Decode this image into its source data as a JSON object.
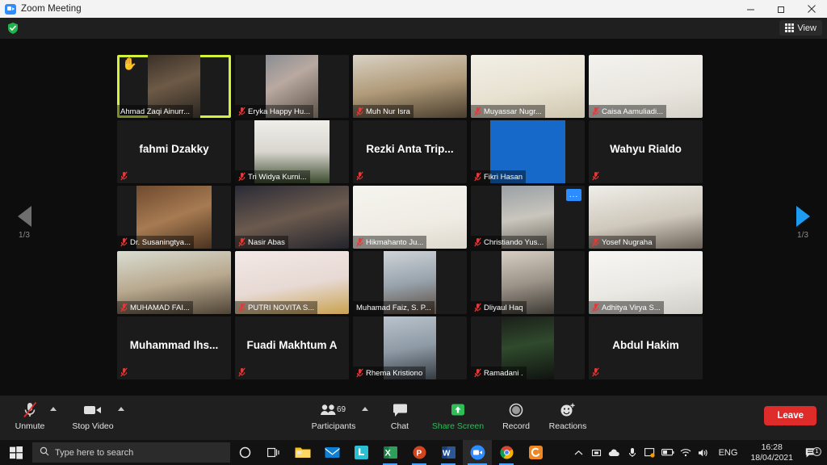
{
  "window": {
    "title": "Zoom Meeting",
    "app_icon": "zoom-icon",
    "minimize_label": "Minimize",
    "maximize_label": "Maximize",
    "close_label": "Close"
  },
  "topbar": {
    "shield_icon": "encryption-shield-icon",
    "view_label": "View",
    "view_icon": "grid-view-icon"
  },
  "page_nav": {
    "prev_label": "1/3",
    "next_label": "1/3",
    "prev_icon": "chevron-left-icon",
    "next_icon": "chevron-right-icon",
    "prev_color": "#6e6e6e",
    "next_color": "#1d9bf0"
  },
  "gallery": {
    "active_speaker_color": "#d4f23a",
    "participants": [
      {
        "name": "Ahmad Zaqi Ainurr...",
        "video": true,
        "muted": false,
        "hand_raised": true,
        "speaking": true,
        "name_style": "bar",
        "crop": "narrow"
      },
      {
        "name": "Eryka Happy Hu...",
        "video": true,
        "muted": true,
        "hand_raised": false,
        "speaking": false,
        "name_style": "bar",
        "crop": "narrow"
      },
      {
        "name": "Muh Nur Isra",
        "video": true,
        "muted": true,
        "hand_raised": false,
        "speaking": false,
        "name_style": "bar",
        "crop": "full"
      },
      {
        "name": "Muyassar Nugr...",
        "video": true,
        "muted": true,
        "hand_raised": false,
        "speaking": false,
        "name_style": "bar",
        "crop": "full"
      },
      {
        "name": "Caisa Aamuliadi...",
        "video": true,
        "muted": true,
        "hand_raised": false,
        "speaking": false,
        "name_style": "bar",
        "crop": "full"
      },
      {
        "name": "fahmi Dzakky",
        "video": false,
        "muted": true,
        "hand_raised": false,
        "speaking": false,
        "name_style": "big",
        "crop": "full"
      },
      {
        "name": "Tri Widya Kurni...",
        "video": true,
        "muted": true,
        "hand_raised": false,
        "speaking": false,
        "name_style": "bar",
        "crop": "mid"
      },
      {
        "name": "Rezki  Anta Trip...",
        "video": false,
        "muted": true,
        "hand_raised": false,
        "speaking": false,
        "name_style": "big",
        "crop": "full"
      },
      {
        "name": "Fikri Hasan",
        "video": true,
        "muted": true,
        "hand_raised": false,
        "speaking": false,
        "name_style": "bar",
        "crop": "mid"
      },
      {
        "name": "Wahyu Rialdo",
        "video": false,
        "muted": true,
        "hand_raised": false,
        "speaking": false,
        "name_style": "big",
        "crop": "full"
      },
      {
        "name": "Dr. Susaningtya...",
        "video": true,
        "muted": true,
        "hand_raised": false,
        "speaking": false,
        "name_style": "bar",
        "crop": "mid"
      },
      {
        "name": "Nasir Abas",
        "video": true,
        "muted": true,
        "hand_raised": false,
        "speaking": false,
        "name_style": "bar",
        "crop": "full"
      },
      {
        "name": "Hikmahanto Ju...",
        "video": true,
        "muted": true,
        "hand_raised": false,
        "speaking": false,
        "name_style": "bar",
        "crop": "full"
      },
      {
        "name": "Christiando Yus...",
        "video": true,
        "muted": true,
        "hand_raised": false,
        "speaking": false,
        "name_style": "bar",
        "crop": "narrow",
        "more_menu": "..."
      },
      {
        "name": "Yosef Nugraha",
        "video": true,
        "muted": true,
        "hand_raised": false,
        "speaking": false,
        "name_style": "bar",
        "crop": "full"
      },
      {
        "name": "MUHAMAD FAI...",
        "video": true,
        "muted": true,
        "hand_raised": false,
        "speaking": false,
        "name_style": "bar",
        "crop": "full"
      },
      {
        "name": "PUTRI NOVITA S...",
        "video": true,
        "muted": true,
        "hand_raised": false,
        "speaking": false,
        "name_style": "bar",
        "crop": "full"
      },
      {
        "name": "Muhamad Faiz, S. P...",
        "video": true,
        "muted": false,
        "hand_raised": false,
        "speaking": false,
        "name_style": "bar",
        "crop": "narrow"
      },
      {
        "name": "Dliyaul Haq",
        "video": true,
        "muted": true,
        "hand_raised": false,
        "speaking": false,
        "name_style": "bar",
        "crop": "narrow"
      },
      {
        "name": "Adhitya Virya S...",
        "video": true,
        "muted": true,
        "hand_raised": false,
        "speaking": false,
        "name_style": "bar",
        "crop": "full"
      },
      {
        "name": "Muhammad  Ihs...",
        "video": false,
        "muted": true,
        "hand_raised": false,
        "speaking": false,
        "name_style": "big",
        "crop": "full"
      },
      {
        "name": "Fuadi Makhtum A",
        "video": false,
        "muted": true,
        "hand_raised": false,
        "speaking": false,
        "name_style": "big",
        "crop": "full"
      },
      {
        "name": "Rhema Kristiono",
        "video": true,
        "muted": true,
        "hand_raised": false,
        "speaking": false,
        "name_style": "bar",
        "crop": "narrow"
      },
      {
        "name": "Ramadani .",
        "video": true,
        "muted": true,
        "hand_raised": false,
        "speaking": false,
        "name_style": "bar",
        "crop": "narrow"
      },
      {
        "name": "Abdul Hakim",
        "video": false,
        "muted": true,
        "hand_raised": false,
        "speaking": false,
        "name_style": "big",
        "crop": "full"
      }
    ]
  },
  "toolbar": {
    "unmute_label": "Unmute",
    "unmute_icon": "microphone-muted-icon",
    "stop_video_label": "Stop Video",
    "stop_video_icon": "video-camera-icon",
    "participants_label": "Participants",
    "participants_count": "69",
    "participants_icon": "people-icon",
    "chat_label": "Chat",
    "chat_icon": "speech-bubble-icon",
    "share_screen_label": "Share Screen",
    "share_screen_icon": "share-screen-icon",
    "share_screen_color": "#2fbd58",
    "record_label": "Record",
    "record_icon": "record-circle-icon",
    "reactions_label": "Reactions",
    "reactions_icon": "smiley-plus-icon",
    "leave_label": "Leave",
    "leave_color": "#e02b2b"
  },
  "taskbar": {
    "start_icon": "windows-start-icon",
    "search_placeholder": "Type here to search",
    "search_icon": "search-icon",
    "cortana_icon": "cortana-icon",
    "taskview_icon": "task-view-icon",
    "apps": [
      {
        "icon": "file-explorer-icon",
        "name": "File Explorer"
      },
      {
        "icon": "mail-icon",
        "name": "Mail"
      },
      {
        "icon": "line-app-icon",
        "name": "LINE"
      },
      {
        "icon": "excel-icon",
        "name": "Excel"
      },
      {
        "icon": "powerpoint-icon",
        "name": "PowerPoint"
      },
      {
        "icon": "word-icon",
        "name": "Word"
      },
      {
        "icon": "zoom-icon",
        "name": "Zoom"
      },
      {
        "icon": "chrome-icon",
        "name": "Google Chrome"
      },
      {
        "icon": "orange-app-icon",
        "name": "App"
      }
    ],
    "tray": {
      "overflow_icon": "chevron-up-icon",
      "language": "ENG",
      "time": "16:28",
      "date": "18/04/2021",
      "notification_icon": "action-center-icon",
      "notification_count": "1"
    }
  }
}
